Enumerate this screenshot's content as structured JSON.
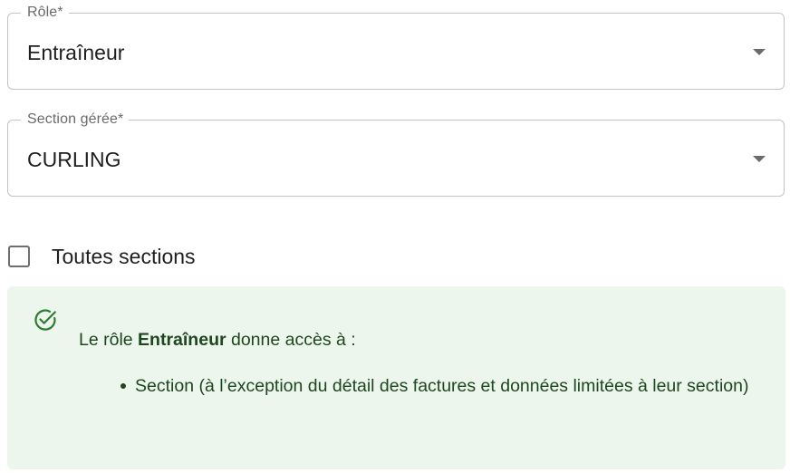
{
  "role_field": {
    "label": "Rôle",
    "required_marker": "*",
    "value": "Entraîneur"
  },
  "section_field": {
    "label": "Section gérée",
    "required_marker": "*",
    "value": "CURLING"
  },
  "all_sections_checkbox": {
    "label": "Toutes sections",
    "checked": false
  },
  "alert": {
    "severity": "success",
    "icon": "check-circle-icon",
    "text_prefix": "Le rôle ",
    "role_name": "Entraîneur",
    "text_suffix": " donne accès à :",
    "permissions": [
      "Section (à l’exception du détail des factures et données limitées à leur section)"
    ]
  },
  "colors": {
    "alert_background": "#edf6ec",
    "alert_text": "#1e4620",
    "alert_icon": "#2e7d32",
    "field_border": "#c4c4c4",
    "label_text": "#6b6b6b"
  }
}
